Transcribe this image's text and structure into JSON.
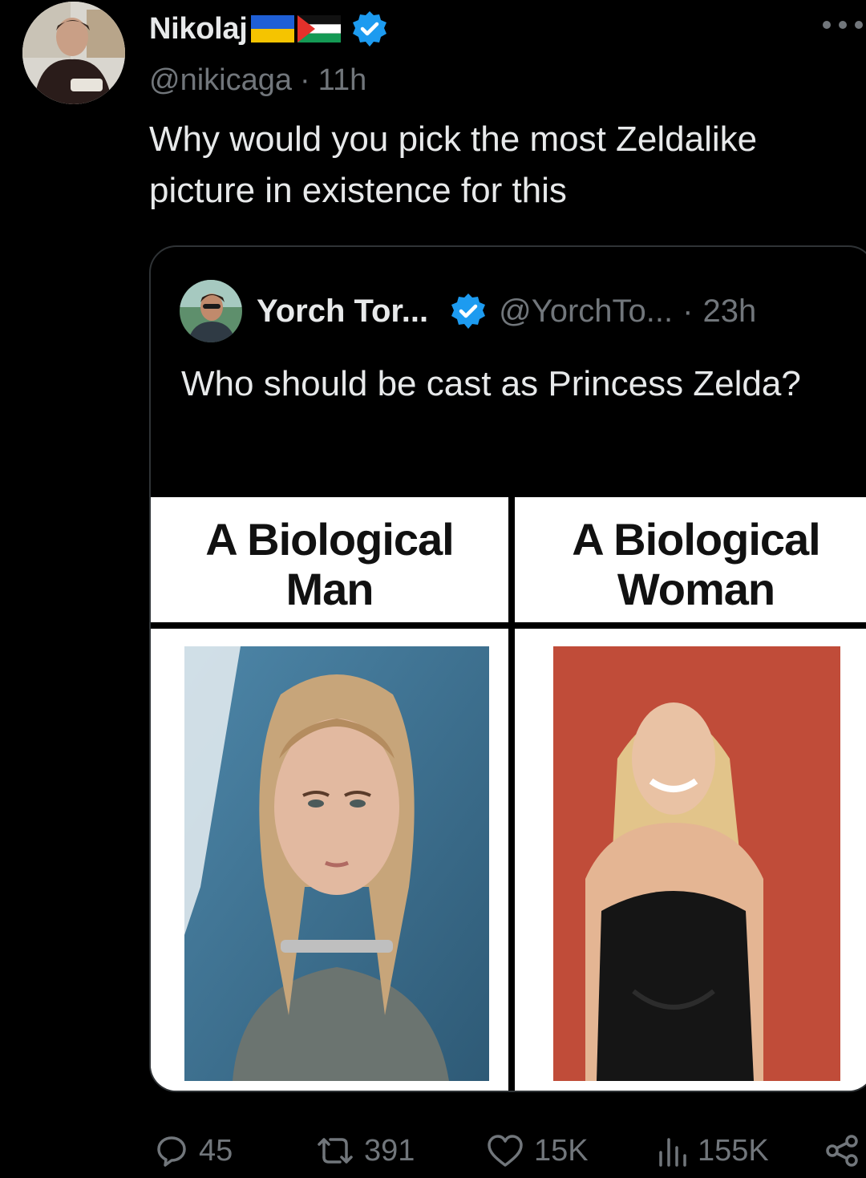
{
  "tweet": {
    "display_name": "Nikolaj",
    "handle": "@nikicaga",
    "separator": "·",
    "time": "11h",
    "text": "Why would you pick the most Zeldalike picture in existence for this",
    "flags": [
      "ukraine-flag",
      "palestine-flag"
    ],
    "verified_icon": "verified-badge-icon",
    "colors": {
      "verified": "#1d9bf0",
      "secondary_text": "#71767b",
      "primary_text": "#e7e9ea",
      "background": "#000000"
    }
  },
  "quote": {
    "display_name": "Yorch Tor...",
    "handle": "@YorchTo...",
    "separator": "·",
    "time": "23h",
    "text": "Who should be cast as Princess Zelda?",
    "image": {
      "left_label_line1": "A Biological",
      "left_label_line2": "Man",
      "right_label_line1": "A Biological",
      "right_label_line2": "Woman"
    }
  },
  "actions": {
    "replies": "45",
    "reposts": "391",
    "likes": "15K",
    "views": "155K",
    "icons": [
      "reply-icon",
      "repost-icon",
      "like-icon",
      "views-icon",
      "share-icon"
    ]
  }
}
